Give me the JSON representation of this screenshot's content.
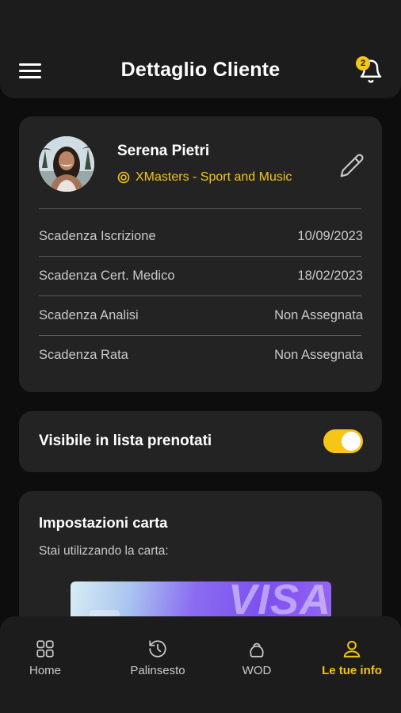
{
  "colors": {
    "accent": "#f5c518",
    "background": "#0d0d0d",
    "card": "#232323",
    "header": "#1c1c1c"
  },
  "header": {
    "title": "Dettaglio Cliente",
    "notification_count": "2",
    "menu_icon": "hamburger-menu-icon",
    "bell_icon": "bell-icon"
  },
  "profile": {
    "name": "Serena Pietri",
    "gym": "XMasters - Sport and Music",
    "gym_icon": "target-icon",
    "edit_icon": "pencil-icon",
    "rows": [
      {
        "label": "Scadenza Iscrizione",
        "value": "10/09/2023"
      },
      {
        "label": "Scadenza Cert. Medico",
        "value": "18/02/2023"
      },
      {
        "label": "Scadenza Analisi",
        "value": "Non Assegnata"
      },
      {
        "label": "Scadenza Rata",
        "value": "Non Assegnata"
      }
    ]
  },
  "visibility": {
    "label": "Visibile in lista prenotati",
    "enabled": true
  },
  "card_settings": {
    "title": "Impostazioni carta",
    "subtitle": "Stai utilizzando la carta:",
    "card_brand": "VISA"
  },
  "nav": {
    "items": [
      {
        "label": "Home",
        "icon": "grid-icon",
        "active": false
      },
      {
        "label": "Palinsesto",
        "icon": "history-icon",
        "active": false
      },
      {
        "label": "WOD",
        "icon": "kettlebell-icon",
        "active": false
      },
      {
        "label": "Le tue info",
        "icon": "user-icon",
        "active": true
      }
    ]
  }
}
